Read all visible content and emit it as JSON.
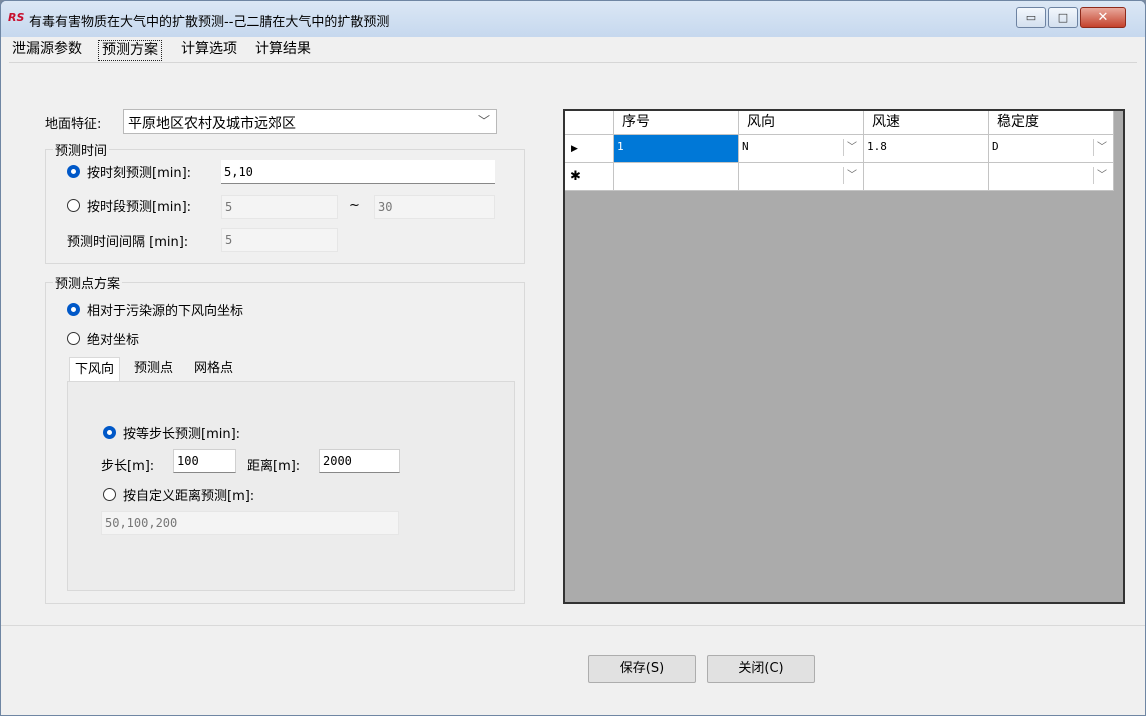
{
  "window": {
    "title": "有毒有害物质在大气中的扩散预测--己二腈在大气中的扩散预测",
    "app_icon": "RS",
    "minimize": "▭",
    "maximize": "□",
    "close": "✕"
  },
  "tabs": [
    "泄漏源参数",
    "预测方案",
    "计算选项",
    "计算结果"
  ],
  "ground": {
    "label": "地面特征:",
    "value": "平原地区农村及城市远郊区"
  },
  "time_group": {
    "title": "预测时间",
    "by_moment_label": "按时刻预测[min]:",
    "by_moment_value": "5,10",
    "by_period_label": "按时段预测[min]:",
    "period_start": "5",
    "period_sep": "~",
    "period_end": "30",
    "interval_label": "预测时间间隔 [min]:",
    "interval_value": "5"
  },
  "point_group": {
    "title": "预测点方案",
    "relative_label": "相对于污染源的下风向坐标",
    "absolute_label": "绝对坐标",
    "subtabs": [
      "下风向",
      "预测点",
      "网格点"
    ],
    "equal_step_label": "按等步长预测[min]:",
    "step_label": "步长[m]:",
    "step_value": "100",
    "distance_label": "距离[m]:",
    "distance_value": "2000",
    "custom_label": "按自定义距离预测[m]:",
    "custom_value": "50,100,200"
  },
  "grid": {
    "headers": [
      "序号",
      "风向",
      "风速",
      "稳定度"
    ],
    "row_pointer": "▶",
    "new_row_marker": "✱",
    "rows": [
      {
        "no": "1",
        "direction": "N",
        "speed": "1.8",
        "stability": "D"
      }
    ]
  },
  "buttons": {
    "save": "保存(S)",
    "close": "关闭(C)"
  }
}
